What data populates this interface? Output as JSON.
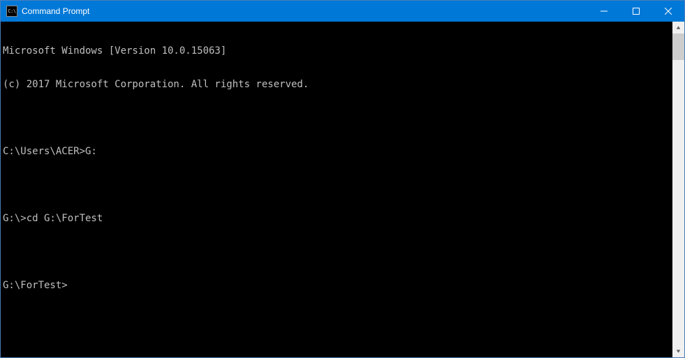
{
  "window": {
    "title": "Command Prompt",
    "icon_label": "C:\\"
  },
  "terminal": {
    "lines": [
      "Microsoft Windows [Version 10.0.15063]",
      "(c) 2017 Microsoft Corporation. All rights reserved.",
      "",
      "C:\\Users\\ACER>G:",
      "",
      "G:\\>cd G:\\ForTest",
      "",
      "G:\\ForTest>"
    ]
  },
  "colors": {
    "titlebar": "#0078d7",
    "background": "#000000",
    "text": "#c0c0c0"
  }
}
